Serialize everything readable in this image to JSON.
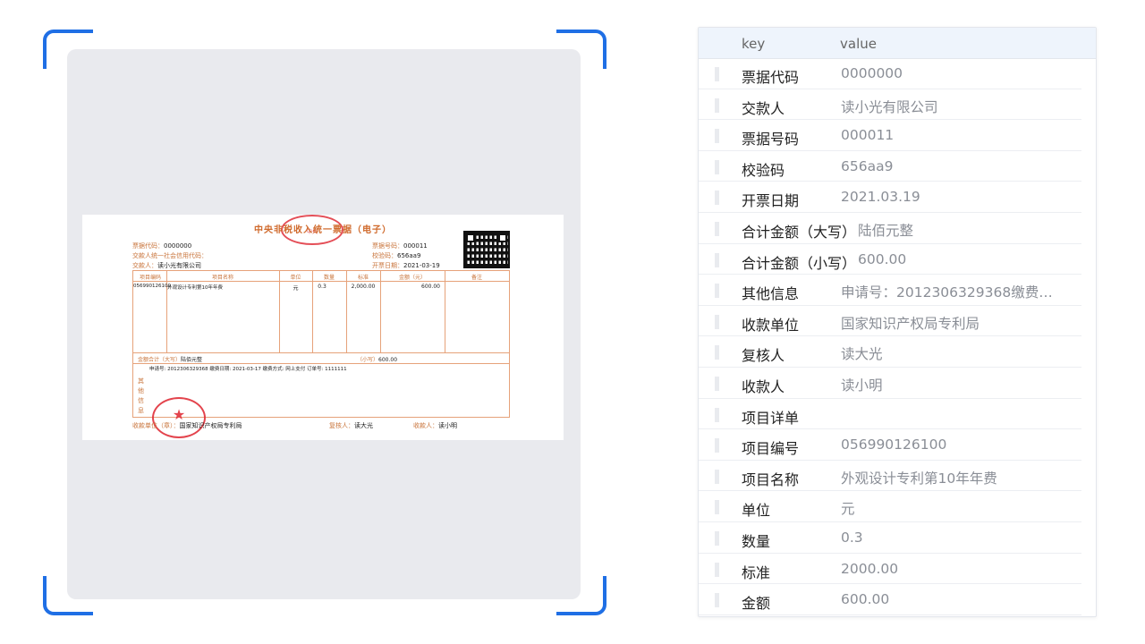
{
  "receipt": {
    "title": "中央非税收入统一票据（电子）",
    "stamp_top_text": "中央",
    "bill_code_label": "票据代码：",
    "bill_code": "0000000",
    "credit_code_label": "交款人统一社会信用代码：",
    "payer_label": "交款人：",
    "payer": "读小光有限公司",
    "bill_no_label": "票据号码：",
    "bill_no": "000011",
    "check_code_label": "校验码：",
    "check_code": "656aa9",
    "issue_date_label": "开票日期：",
    "issue_date": "2021-03-19",
    "columns": [
      "项目编码",
      "项目名称",
      "单位",
      "数量",
      "标准",
      "金额（元）",
      "备注"
    ],
    "row": {
      "code": "056990126100",
      "name": "外观设计专利第10年年费",
      "unit": "元",
      "qty": "0.3",
      "standard": "2,000.00",
      "amount": "600.00"
    },
    "total_upper_label": "金额合计（大写）",
    "total_upper": "陆佰元整",
    "total_lower_label": "（小写）",
    "total_lower": "600.00",
    "other_info_label": "其他信息",
    "other_info": "申请号: 2012306329368 缴费日期: 2021-03-17 缴费方式: 网上支付 订单号: 1111111",
    "payee_label": "收款单位（章）：",
    "payee": "国家知识产权局专利局",
    "reviewer_label": "复核人：",
    "reviewer": "读大光",
    "collector_label": "收款人：",
    "collector": "读小明"
  },
  "kv_table": {
    "header_key": "key",
    "header_value": "value",
    "rows": [
      {
        "key": "票据代码",
        "value": "0000000"
      },
      {
        "key": "交款人",
        "value": "读小光有限公司"
      },
      {
        "key": "票据号码",
        "value": "000011"
      },
      {
        "key": "校验码",
        "value": "656aa9"
      },
      {
        "key": "开票日期",
        "value": "2021.03.19"
      },
      {
        "key": "合计金额（大写）",
        "value": "陆佰元整"
      },
      {
        "key": "合计金额（小写）",
        "value": "600.00"
      },
      {
        "key": "其他信息",
        "value": "申请号：2012306329368缴费…"
      },
      {
        "key": "收款单位",
        "value": "国家知识产权局专利局"
      },
      {
        "key": "复核人",
        "value": "读大光"
      },
      {
        "key": "收款人",
        "value": "读小明"
      },
      {
        "key": "项目详单",
        "value": ""
      },
      {
        "key": "项目编号",
        "value": "056990126100"
      },
      {
        "key": "项目名称",
        "value": "外观设计专利第10年年费"
      },
      {
        "key": "单位",
        "value": "元"
      },
      {
        "key": "数量",
        "value": "0.3"
      },
      {
        "key": "标准",
        "value": "2000.00"
      },
      {
        "key": "金额",
        "value": "600.00"
      }
    ]
  },
  "colors": {
    "accent": "#1f6fe5",
    "receipt_line": "#e6a27a",
    "stamp": "#e0303a"
  }
}
